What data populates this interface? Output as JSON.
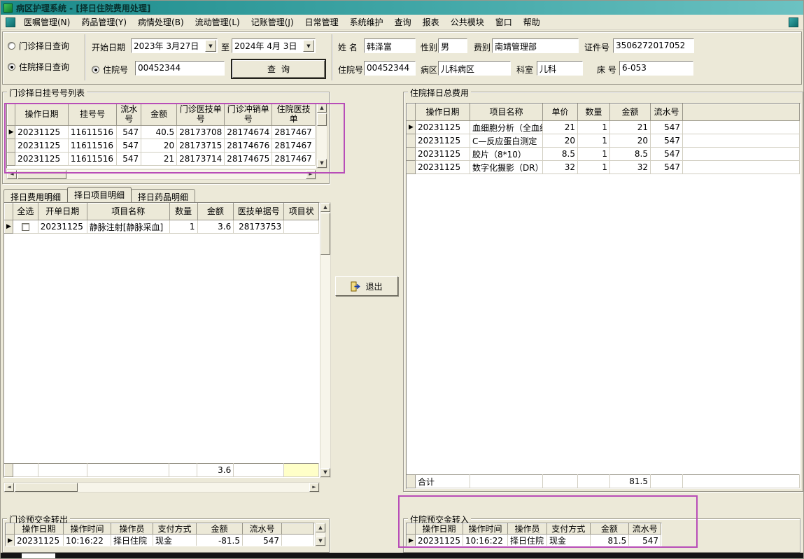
{
  "window": {
    "title": "病区护理系统 - [择日住院费用处理]"
  },
  "menu": {
    "items": [
      "医嘱管理(N)",
      "药品管理(Y)",
      "病情处理(B)",
      "流动管理(L)",
      "记账管理(J)",
      "日常管理",
      "系统维护",
      "查询",
      "报表",
      "公共模块",
      "窗口",
      "帮助"
    ]
  },
  "icons": {
    "dropdown": "▼",
    "scroll_up": "▲",
    "scroll_down": "▼",
    "scroll_left": "◄",
    "scroll_right": "►",
    "row_marker": "▶"
  },
  "query": {
    "radio_outpatient": "门诊择日查询",
    "radio_inpatient": "住院择日查询",
    "start_date_label": "开始日期",
    "start_date": "2023年 3月27日",
    "to_label": "至",
    "end_date": "2024年 4月 3日",
    "radio_admission_no": "住院号",
    "admission_no_value": "00452344",
    "search_button": "查询",
    "patient": {
      "name_label": "姓 名",
      "name": "韩泽富",
      "gender_label": "性别",
      "gender": "男",
      "fee_type_label": "费别",
      "fee_type": "南靖管理部",
      "id_label": "证件号",
      "id": "3506272017052",
      "admission_label": "住院号",
      "admission": "00452344",
      "ward_label": "病区",
      "ward": "儿科病区",
      "dept_label": "科室",
      "dept": "儿科",
      "bed_label": "床 号",
      "bed": "6-053"
    }
  },
  "groups": {
    "outpatient_reg_title": "门诊择日挂号号列表",
    "inpatient_total_title": "住院择日总费用",
    "outpatient_prepay_title": "门诊预交金转出",
    "inpatient_prepay_title": "住院预交金转入"
  },
  "tabs": [
    "择日费用明细",
    "择日项目明细",
    "择日药品明细"
  ],
  "exit_button": "退出",
  "annotations": {
    "color": "#b84db8"
  },
  "tables": {
    "outpatient_reg": {
      "headers": [
        "操作日期",
        "挂号号",
        "流水号",
        "金额",
        "门诊医技单号",
        "门诊冲销单号",
        "住院医技单"
      ],
      "rows": [
        [
          "20231125",
          "11611516",
          "547",
          "40.5",
          "28173708",
          "28174674",
          "2817467"
        ],
        [
          "20231125",
          "11611516",
          "547",
          "20",
          "28173715",
          "28174676",
          "2817467"
        ],
        [
          "20231125",
          "11611516",
          "547",
          "21",
          "28173714",
          "28174675",
          "2817467"
        ]
      ],
      "selected_row": 0
    },
    "item_detail": {
      "headers": [
        "全选",
        "开单日期",
        "项目名称",
        "数量",
        "金额",
        "医技单据号",
        "项目状"
      ],
      "rows": [
        [
          "",
          "20231125",
          "静脉注射[静脉采血]",
          "1",
          "3.6",
          "28173753",
          ""
        ]
      ],
      "selected_row": 0,
      "footer": [
        "",
        "",
        "",
        "",
        "3.6",
        "",
        ""
      ]
    },
    "inpatient_total": {
      "headers": [
        "操作日期",
        "项目名称",
        "单价",
        "数量",
        "金额",
        "流水号"
      ],
      "rows": [
        [
          "20231125",
          "血细胞分析（全血细",
          "21",
          "1",
          "21",
          "547"
        ],
        [
          "20231125",
          "C—反应蛋白测定（",
          "20",
          "1",
          "20",
          "547"
        ],
        [
          "20231125",
          "胶片（8*10）",
          "8.5",
          "1",
          "8.5",
          "547"
        ],
        [
          "20231125",
          "数字化摄影（DR）",
          "32",
          "1",
          "32",
          "547"
        ]
      ],
      "selected_row": 0,
      "footer": [
        "合计",
        "",
        "",
        "",
        "81.5",
        ""
      ]
    },
    "outpatient_prepay": {
      "headers": [
        "操作日期",
        "操作时间",
        "操作员",
        "支付方式",
        "金额",
        "流水号"
      ],
      "rows": [
        [
          "20231125",
          "10:16:22",
          "择日住院",
          "现金",
          "-81.5",
          "547"
        ]
      ],
      "selected_row": 0
    },
    "inpatient_prepay": {
      "headers": [
        "操作日期",
        "操作时间",
        "操作员",
        "支付方式",
        "金额",
        "流水号"
      ],
      "rows": [
        [
          "20231125",
          "10:16:22",
          "择日住院",
          "现金",
          "81.5",
          "547"
        ]
      ],
      "selected_row": 0
    }
  }
}
